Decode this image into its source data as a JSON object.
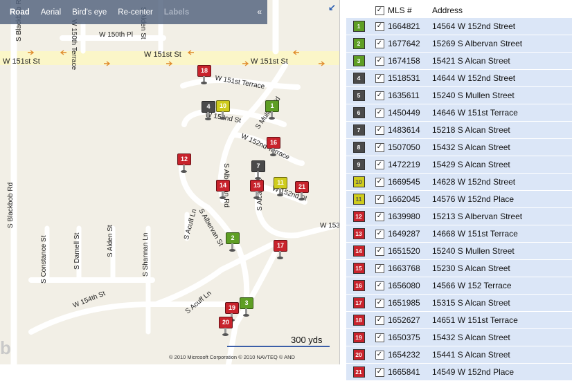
{
  "toolbar": {
    "items": [
      "Road",
      "Aerial",
      "Bird's eye",
      "Re-center",
      "Labels"
    ],
    "collapse": "«"
  },
  "colors": {
    "red": "#c8232c",
    "green": "#5e9e24",
    "yellow": "#cfcc1d",
    "gray": "#4a4a4a"
  },
  "streets": [
    "S Blackbob Rd",
    "W 150th Terrace",
    "W 150th Pl",
    "S Alden St",
    "W 151st St",
    "W 151st St",
    "W 151st Terrace",
    "S Mullen Rd",
    "W 152nd St",
    "W 152nd Terrace",
    "S Albervan Rd",
    "W 152nd Pl",
    "W 153",
    "S Alcan St",
    "S Acuff Ln",
    "S Albervan St",
    "S Constance St",
    "S Darnell St",
    "S Alden St",
    "S Shannan Ln",
    "W 154th St",
    "S Acuff Ln",
    "S Blackbob Rd"
  ],
  "pins": [
    {
      "num": "1",
      "color": "green"
    },
    {
      "num": "2",
      "color": "green"
    },
    {
      "num": "3",
      "color": "green"
    },
    {
      "num": "4",
      "color": "gray"
    },
    {
      "num": "7",
      "color": "gray"
    },
    {
      "num": "10",
      "color": "yellow"
    },
    {
      "num": "11",
      "color": "yellow"
    },
    {
      "num": "12",
      "color": "red"
    },
    {
      "num": "14",
      "color": "red"
    },
    {
      "num": "15",
      "color": "red"
    },
    {
      "num": "16",
      "color": "red"
    },
    {
      "num": "17",
      "color": "red"
    },
    {
      "num": "18",
      "color": "red"
    },
    {
      "num": "19",
      "color": "red"
    },
    {
      "num": "20",
      "color": "red"
    },
    {
      "num": "21",
      "color": "red"
    }
  ],
  "scale": "300 yds",
  "copyright": "© 2010 Microsoft Corporation    © 2010 NAVTEQ    © AND",
  "logo": "b",
  "list": {
    "header": {
      "mls": "MLS #",
      "address": "Address"
    },
    "rows": [
      {
        "num": "1",
        "color": "green",
        "mls": "1664821",
        "address": "14564 W 152nd Street"
      },
      {
        "num": "2",
        "color": "green",
        "mls": "1677642",
        "address": "15269 S Albervan Street"
      },
      {
        "num": "3",
        "color": "green",
        "mls": "1674158",
        "address": "15421 S Alcan Street"
      },
      {
        "num": "4",
        "color": "gray",
        "mls": "1518531",
        "address": "14644 W 152nd Street"
      },
      {
        "num": "5",
        "color": "gray",
        "mls": "1635611",
        "address": "15240 S Mullen Street"
      },
      {
        "num": "6",
        "color": "gray",
        "mls": "1450449",
        "address": "14646 W 151st Terrace"
      },
      {
        "num": "7",
        "color": "gray",
        "mls": "1483614",
        "address": "15218 S Alcan Street"
      },
      {
        "num": "8",
        "color": "gray",
        "mls": "1507050",
        "address": "15432 S Alcan Street"
      },
      {
        "num": "9",
        "color": "gray",
        "mls": "1472219",
        "address": "15429 S Alcan Street"
      },
      {
        "num": "10",
        "color": "yellow",
        "mls": "1669545",
        "address": "14628 W 152nd Street"
      },
      {
        "num": "11",
        "color": "yellow",
        "mls": "1662045",
        "address": "14576 W 152nd Place"
      },
      {
        "num": "12",
        "color": "red",
        "mls": "1639980",
        "address": "15213 S Albervan Street"
      },
      {
        "num": "13",
        "color": "red",
        "mls": "1649287",
        "address": "14668 W 151st Terrace"
      },
      {
        "num": "14",
        "color": "red",
        "mls": "1651520",
        "address": "15240 S Mullen Street"
      },
      {
        "num": "15",
        "color": "red",
        "mls": "1663768",
        "address": "15230 S Alcan Street"
      },
      {
        "num": "16",
        "color": "red",
        "mls": "1656080",
        "address": "14566 W 152 Terrace"
      },
      {
        "num": "17",
        "color": "red",
        "mls": "1651985",
        "address": "15315 S Alcan Street"
      },
      {
        "num": "18",
        "color": "red",
        "mls": "1652627",
        "address": "14651 W 151st Terrace"
      },
      {
        "num": "19",
        "color": "red",
        "mls": "1650375",
        "address": "15432 S Alcan Street"
      },
      {
        "num": "20",
        "color": "red",
        "mls": "1654232",
        "address": "15441 S Alcan Street"
      },
      {
        "num": "21",
        "color": "red",
        "mls": "1665841",
        "address": "14549 W 152nd Place"
      }
    ]
  }
}
